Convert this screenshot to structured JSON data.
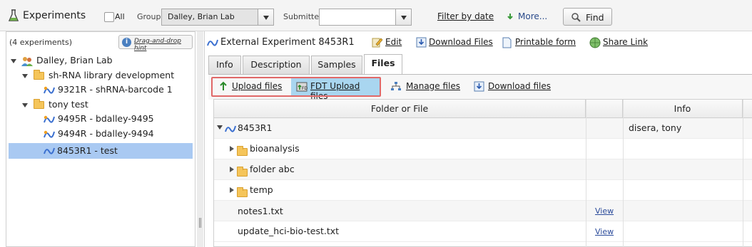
{
  "topbar": {
    "title": "Experiments",
    "all_label": "All",
    "group_label": "Group",
    "group_value": "Dalley, Brian Lab",
    "submitter_label": "Submitter",
    "submitter_value": "",
    "filter_by_date": "Filter by date",
    "more": "More...",
    "find": "Find"
  },
  "left": {
    "count": "(4 experiments)",
    "hint": "Drag-and-drop hint",
    "tree": {
      "lab": "Dalley, Brian Lab",
      "folder1": "sh-RNA library development",
      "exp1": "9321R - shRNA-barcode 1",
      "folder2": "tony test",
      "exp2": "9495R - bdalley-9495",
      "exp3": "9494R - bdalley-9494",
      "exp4": "8453R1 - test"
    }
  },
  "right": {
    "title": "External Experiment 8453R1",
    "edit": "Edit",
    "download_files": "Download Files",
    "printable_form": "Printable form",
    "share_link": "Share Link",
    "tabs": [
      "Info",
      "Description",
      "Samples",
      "Files"
    ],
    "active_tab": "Files",
    "toolbar": {
      "upload_files": "Upload files",
      "fdt_upload": "FDT Upload files",
      "manage_files": "Manage files",
      "download_files": "Download files"
    },
    "grid": {
      "col_folder": "Folder or File",
      "col_info": "Info",
      "rows": [
        {
          "name": "8453R1",
          "info": "disera, tony",
          "view": ""
        },
        {
          "name": "bioanalysis",
          "info": "",
          "view": ""
        },
        {
          "name": "folder abc",
          "info": "",
          "view": ""
        },
        {
          "name": "temp",
          "info": "",
          "view": ""
        },
        {
          "name": "notes1.txt",
          "info": "",
          "view": "View"
        },
        {
          "name": "update_hci-bio-test.txt",
          "info": "",
          "view": "View"
        }
      ]
    }
  },
  "colors": {
    "selected_row": "#a9c9f2",
    "highlight_border": "#e06868",
    "fdt_button": "#a9d6f0",
    "folder": "#f5c55a"
  }
}
